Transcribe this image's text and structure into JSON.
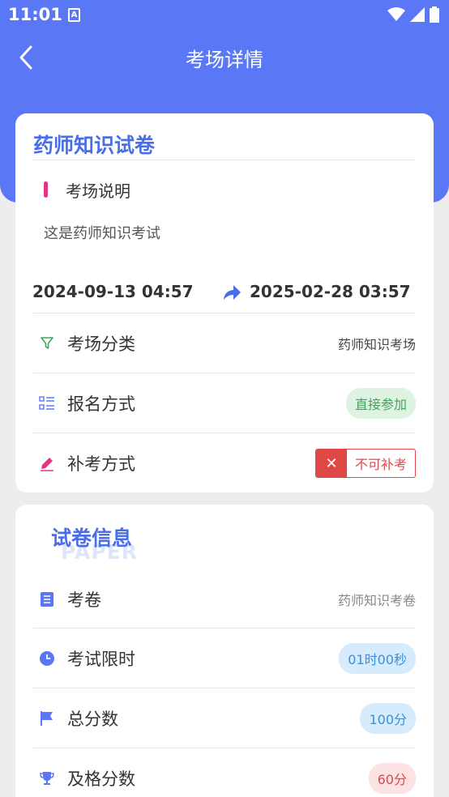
{
  "status_bar": {
    "time": "11:01",
    "app_glyph": "A"
  },
  "nav": {
    "title": "考场详情",
    "back_icon": "back-chevron-icon"
  },
  "exam": {
    "title": "药师知识试卷",
    "section_title": "考场说明",
    "description": "这是药师知识考试",
    "start_time": "2024-09-13 04:57",
    "end_time": "2025-02-28 03:57",
    "rows": {
      "category": {
        "label": "考场分类",
        "value": "药师知识考场",
        "icon": "filter-icon"
      },
      "signup": {
        "label": "报名方式",
        "value": "直接参加",
        "icon": "list-icon"
      },
      "makeup": {
        "label": "补考方式",
        "value": "不可补考",
        "icon": "pencil-icon",
        "badge_icon": "close-icon"
      }
    }
  },
  "paper": {
    "title": "试卷信息",
    "watermark": "PAPER",
    "rows": {
      "paper": {
        "label": "考卷",
        "value": "药师知识考卷",
        "icon": "document-icon"
      },
      "time_limit": {
        "label": "考试限时",
        "value": "01时00秒",
        "icon": "clock-icon"
      },
      "total_score": {
        "label": "总分数",
        "value": "100分",
        "icon": "flag-icon"
      },
      "pass_score": {
        "label": "及格分数",
        "value": "60分",
        "icon": "trophy-icon"
      }
    }
  },
  "colors": {
    "primary": "#5a78f5",
    "accent_pink": "#e0368a",
    "green": "#3ea55a",
    "blue": "#3a8fe0",
    "red": "#e04848"
  }
}
